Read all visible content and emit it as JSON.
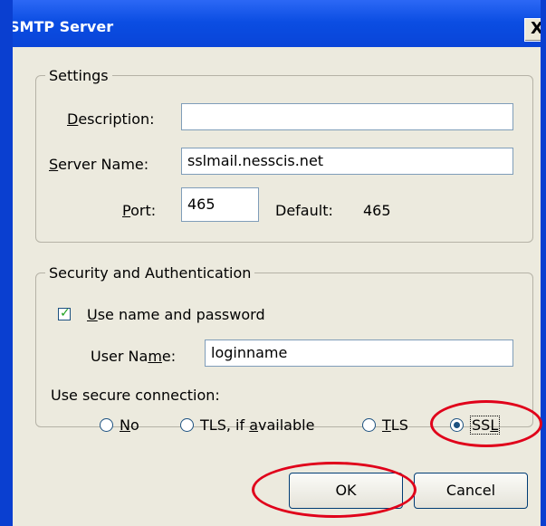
{
  "window": {
    "title": "SMTP Server",
    "close_label": "X"
  },
  "settings": {
    "legend": "Settings",
    "description_label": "Description:",
    "description_value": "",
    "server_label": "Server Name:",
    "server_value": "sslmail.nesscis.net",
    "port_label": "Port:",
    "port_value": "465",
    "default_label": "Default:",
    "default_value": "465"
  },
  "security": {
    "legend": "Security and Authentication",
    "use_name_label": "Use name and password",
    "use_name_checked": true,
    "username_label": "User Name:",
    "username_value": "loginname",
    "secure_connection_label": "Use secure connection:",
    "options": [
      {
        "label": "No",
        "selected": false
      },
      {
        "label": "TLS, if available",
        "selected": false
      },
      {
        "label": "TLS",
        "selected": false
      },
      {
        "label": "SSL",
        "selected": true
      }
    ]
  },
  "buttons": {
    "ok": "OK",
    "cancel": "Cancel"
  },
  "colors": {
    "titlebar": "#0841d4",
    "dialog_bg": "#eceade",
    "highlight_circle": "#e0001a"
  }
}
